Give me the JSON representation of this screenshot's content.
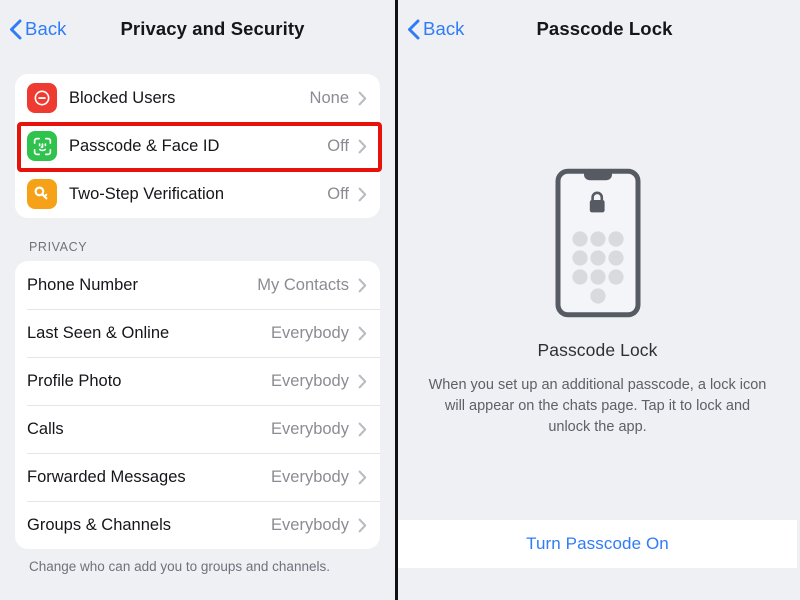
{
  "left_panel": {
    "nav": {
      "back_label": "Back",
      "back_icon": "chevron-left-icon",
      "title": "Privacy and Security"
    },
    "security_card": [
      {
        "icon": "blocked-users-icon",
        "icon_bg": "#ef3a32",
        "label": "Blocked Users",
        "value": "None",
        "chevron": "chevron-right-icon"
      },
      {
        "icon": "face-id-icon",
        "icon_bg": "#2fc24d",
        "label": "Passcode & Face ID",
        "value": "Off",
        "chevron": "chevron-right-icon"
      },
      {
        "icon": "key-icon",
        "icon_bg": "#f5a218",
        "label": "Two-Step Verification",
        "value": "Off",
        "chevron": "chevron-right-icon"
      }
    ],
    "privacy_section": {
      "header": "PRIVACY",
      "rows": [
        {
          "label": "Phone Number",
          "value": "My Contacts",
          "chevron": "chevron-right-icon"
        },
        {
          "label": "Last Seen & Online",
          "value": "Everybody",
          "chevron": "chevron-right-icon"
        },
        {
          "label": "Profile Photo",
          "value": "Everybody",
          "chevron": "chevron-right-icon"
        },
        {
          "label": "Calls",
          "value": "Everybody",
          "chevron": "chevron-right-icon"
        },
        {
          "label": "Forwarded Messages",
          "value": "Everybody",
          "chevron": "chevron-right-icon"
        },
        {
          "label": "Groups & Channels",
          "value": "Everybody",
          "chevron": "chevron-right-icon"
        }
      ],
      "footer": "Change who can add you to groups and channels."
    }
  },
  "right_panel": {
    "nav": {
      "back_label": "Back",
      "back_icon": "chevron-left-icon",
      "title": "Passcode Lock"
    },
    "hero": {
      "illustration": "phone-with-lock-and-keypad-icon",
      "title": "Passcode Lock",
      "description": "When you set up an additional passcode, a lock icon will appear on the chats page. Tap it to lock and unlock the app."
    },
    "action": {
      "label": "Turn Passcode On"
    }
  },
  "annotations": {
    "highlight_color": "#e8120c",
    "boxes": [
      {
        "target": "Passcode & Face ID"
      },
      {
        "target": "Turn Passcode On"
      }
    ]
  },
  "colors": {
    "page_background": "#eff0f4",
    "card_background": "#ffffff",
    "accent_blue": "#2f7cf6",
    "text_primary": "#15161a",
    "text_secondary": "#8b8c93",
    "highlight_red": "#e8120c"
  }
}
